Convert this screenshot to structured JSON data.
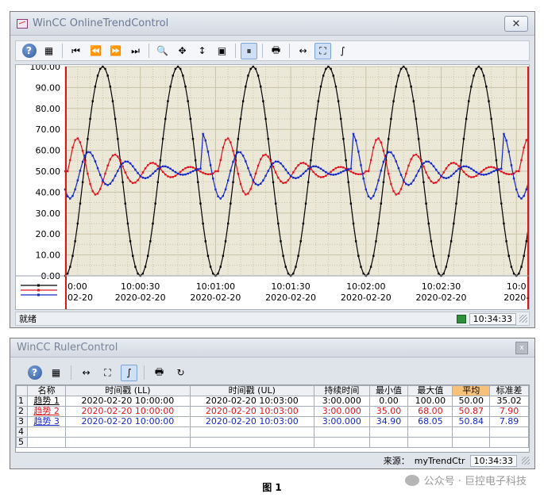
{
  "trend": {
    "title": "WinCC OnlineTrendControl",
    "close_glyph": "✕",
    "toolbar": [
      {
        "name": "help",
        "glyph": "?"
      },
      {
        "name": "config",
        "glyph": "▦"
      },
      {
        "name": "first",
        "glyph": "⏮"
      },
      {
        "name": "prev",
        "glyph": "⏪"
      },
      {
        "name": "next",
        "glyph": "⏩"
      },
      {
        "name": "last",
        "glyph": "⏭"
      },
      {
        "name": "zoom-area",
        "glyph": "🔍"
      },
      {
        "name": "move",
        "glyph": "✥"
      },
      {
        "name": "zoom-y",
        "glyph": "↕"
      },
      {
        "name": "original-view",
        "glyph": "▣"
      },
      {
        "name": "start-stop",
        "glyph": "⏸"
      },
      {
        "name": "print",
        "glyph": "🖶"
      },
      {
        "name": "ruler",
        "glyph": "↔"
      },
      {
        "name": "select-area",
        "glyph": "⛶"
      },
      {
        "name": "statistics",
        "glyph": "∫"
      }
    ],
    "status_text": "就绪",
    "status_time": "10:34:33",
    "chart": {
      "y_ticks": [
        "100.00",
        "90.00",
        "80.00",
        "70.00",
        "60.00",
        "50.00",
        "40.00",
        "30.00",
        "20.00",
        "10.00",
        "0.00"
      ],
      "x_ticks": [
        {
          "time": "0:00",
          "date": "02-20"
        },
        {
          "time": "10:00:30",
          "date": "2020-02-20"
        },
        {
          "time": "10:01:00",
          "date": "2020-02-20"
        },
        {
          "time": "10:01:30",
          "date": "2020-02-20"
        },
        {
          "time": "10:02:00",
          "date": "2020-02-20"
        },
        {
          "time": "10:02:30",
          "date": "2020-02-20"
        },
        {
          "time": "10:0",
          "date": "2020-"
        }
      ],
      "colors": {
        "black": "#000000",
        "red": "#e0141e",
        "blue": "#1428c8",
        "plot_bg": "#ece8d8",
        "grid": "#c9c2a6"
      }
    }
  },
  "chart_data": {
    "type": "line",
    "ylim": [
      0,
      100
    ],
    "x_range": [
      "10:00:00",
      "10:03:00"
    ],
    "series": [
      {
        "name": "趋势 1",
        "color": "#000000",
        "min": 0.0,
        "max": 100.0,
        "avg": 50.0,
        "period_s": 30,
        "phase": "peak at 10:00:15"
      },
      {
        "name": "趋势 2",
        "color": "#e0141e",
        "min": 35.0,
        "max": 68.0,
        "avg": 50.87
      },
      {
        "name": "趋势 3",
        "color": "#1428c8",
        "min": 34.9,
        "max": 68.05,
        "avg": 50.84
      }
    ]
  },
  "ruler": {
    "title": "WinCC RulerControl",
    "close_glyph": "x",
    "toolbar": [
      {
        "name": "help",
        "glyph": "?"
      },
      {
        "name": "config",
        "glyph": "▦"
      },
      {
        "name": "ruler",
        "glyph": "↔"
      },
      {
        "name": "select-area",
        "glyph": "⛶"
      },
      {
        "name": "statistics",
        "glyph": "∫"
      },
      {
        "name": "print",
        "glyph": "🖶"
      },
      {
        "name": "export",
        "glyph": "↻"
      }
    ],
    "columns": [
      "名称",
      "时间戳 (LL)",
      "时间戳 (UL)",
      "持续时间",
      "最小值",
      "最大值",
      "平均",
      "标准差"
    ],
    "rows": [
      {
        "num": "1",
        "color": "#000000",
        "cells": [
          "趋势 1",
          "2020-02-20 10:00:00",
          "2020-02-20 10:03:00",
          "3:00.000",
          "0.00",
          "100.00",
          "50.00",
          "35.02"
        ]
      },
      {
        "num": "2",
        "color": "#e0141e",
        "cells": [
          "趋势 2",
          "2020-02-20 10:00:00",
          "2020-02-20 10:03:00",
          "3:00.000",
          "35.00",
          "68.00",
          "50.87",
          "7.90"
        ]
      },
      {
        "num": "3",
        "color": "#1428c8",
        "cells": [
          "趋势 3",
          "2020-02-20 10:00:00",
          "2020-02-20 10:03:00",
          "3:00.000",
          "34.90",
          "68.05",
          "50.84",
          "7.89"
        ]
      },
      {
        "num": "4",
        "color": "#000000",
        "cells": [
          "",
          "",
          "",
          "",
          "",
          "",
          "",
          ""
        ]
      },
      {
        "num": "5",
        "color": "#000000",
        "cells": [
          "",
          "",
          "",
          "",
          "",
          "",
          "",
          ""
        ]
      }
    ],
    "source_label": "来源：",
    "source_value": "myTrendCtr",
    "status_time": "10:34:33"
  },
  "caption": "图 1",
  "watermark": "公众号 · 巨控电子科技"
}
